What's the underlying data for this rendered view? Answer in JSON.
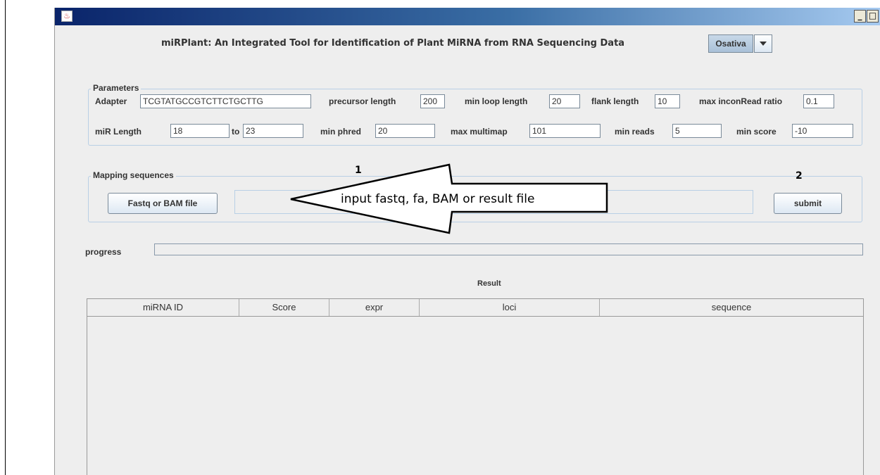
{
  "window": {
    "app_title": "miRPlant: An Integrated Tool for Identification of Plant MiRNA from RNA Sequencing Data",
    "species_select": {
      "value": "Osativa"
    },
    "title_controls": {
      "minimize": "_",
      "maximize": "□"
    }
  },
  "parameters": {
    "group_label": "Parameters",
    "adapter": {
      "label": "Adapter",
      "value": "TCGTATGCCGTCTTCTGCTTG"
    },
    "precursor_length": {
      "label": "precursor length",
      "value": "200"
    },
    "min_loop_length": {
      "label": "min loop length",
      "value": "20"
    },
    "flank_length": {
      "label": "flank length",
      "value": "10"
    },
    "max_inconread_ratio": {
      "label": "max inconRead ratio",
      "value": "0.1"
    },
    "mir_length": {
      "label": "miR Length",
      "from": "18",
      "to_label": "to",
      "to": "23"
    },
    "min_phred": {
      "label": "min phred",
      "value": "20"
    },
    "max_multimap": {
      "label": "max multimap",
      "value": "101"
    },
    "min_reads": {
      "label": "min reads",
      "value": "5"
    },
    "min_score": {
      "label": "min score",
      "value": "-10"
    }
  },
  "mapping": {
    "group_label": "Mapping sequences",
    "file_button": "Fastq or BAM file",
    "file_path": "",
    "submit_button": "submit"
  },
  "progress": {
    "label": "progress",
    "value": 0
  },
  "result": {
    "title": "Result",
    "columns": [
      "miRNA ID",
      "Score",
      "expr",
      "loci",
      "sequence"
    ],
    "rows": []
  },
  "annotations": {
    "arrow_text": "input fastq, fa, BAM or result file",
    "step1": "1",
    "step2": "2"
  }
}
